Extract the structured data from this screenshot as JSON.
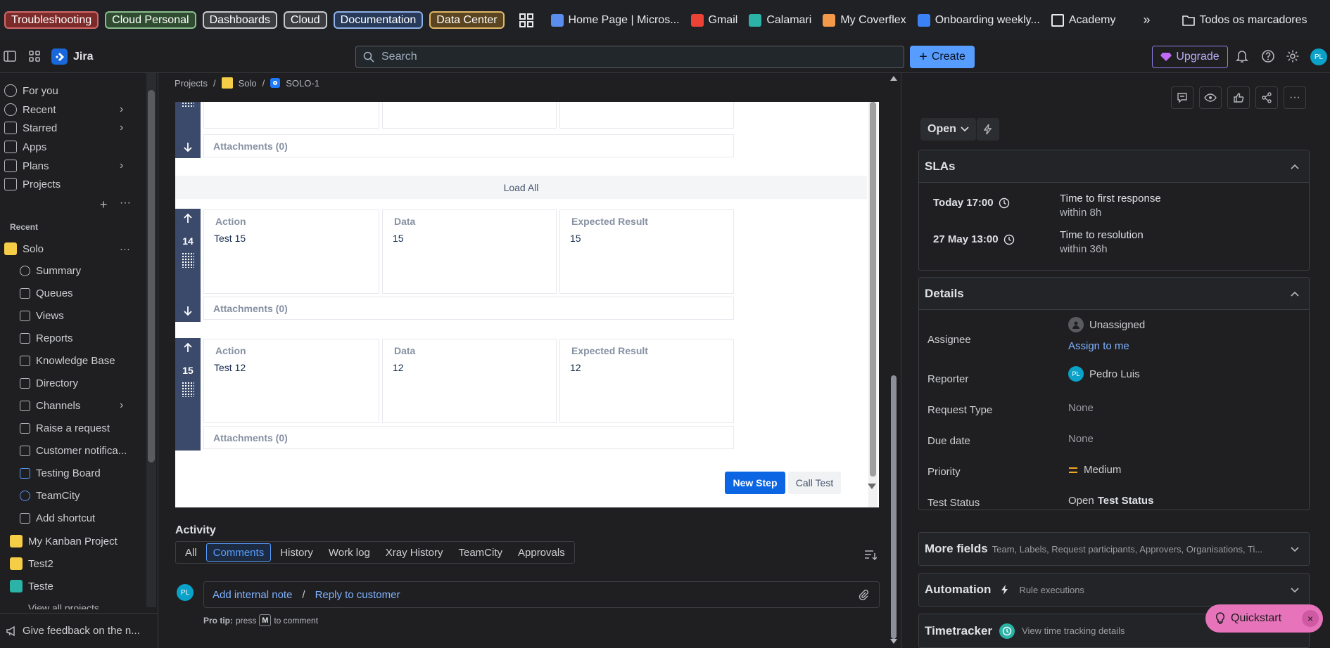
{
  "bookmarks": {
    "folders": [
      {
        "label": "Troubleshooting",
        "bg": "#7d2a2a",
        "border": "#d0686a"
      },
      {
        "label": "Cloud Personal",
        "bg": "#2f4c30",
        "border": "#8bbd8e"
      },
      {
        "label": "Dashboards",
        "bg": "#3b3d40",
        "border": "#c8c9cc"
      },
      {
        "label": "Cloud",
        "bg": "#3b3d40",
        "border": "#c8c9cc"
      },
      {
        "label": "Documentation",
        "bg": "#283a5a",
        "border": "#8fb0e8"
      },
      {
        "label": "Data Center",
        "bg": "#5a4520",
        "border": "#e0b768"
      }
    ],
    "links": [
      {
        "label": "Home Page | Micros...",
        "icon": "microsoft-icon",
        "color": "#5b8def"
      },
      {
        "label": "Gmail",
        "icon": "gmail-icon",
        "color": "#ea4335"
      },
      {
        "label": "Calamari",
        "icon": "calamari-icon",
        "color": "#2ab3a6"
      },
      {
        "label": "My Coverflex",
        "icon": "coverflex-icon",
        "color": "#f2994a"
      },
      {
        "label": "Onboarding weekly...",
        "icon": "onboarding-icon",
        "color": "#3b82f6"
      },
      {
        "label": "Academy",
        "icon": "folder-icon",
        "color": "#e8eaed"
      }
    ],
    "other_folder": "Todos os marcadores"
  },
  "topnav": {
    "app_name": "Jira",
    "search_placeholder": "Search",
    "create_label": "Create",
    "upgrade_label": "Upgrade",
    "avatar_initials": "PL"
  },
  "sidebar": {
    "items": [
      {
        "label": "For you",
        "icon": "user-circle-icon"
      },
      {
        "label": "Recent",
        "icon": "clock-icon"
      },
      {
        "label": "Starred",
        "icon": "star-icon"
      },
      {
        "label": "Apps",
        "icon": "apps-icon"
      },
      {
        "label": "Plans",
        "icon": "plans-icon"
      },
      {
        "label": "Projects",
        "icon": "projects-icon"
      }
    ],
    "recent_label": "Recent",
    "project": "Solo",
    "sub_items": [
      {
        "label": "Summary",
        "icon": "globe-icon"
      },
      {
        "label": "Queues",
        "icon": "queues-icon"
      },
      {
        "label": "Views",
        "icon": "views-icon"
      },
      {
        "label": "Reports",
        "icon": "reports-icon"
      },
      {
        "label": "Knowledge Base",
        "icon": "book-icon"
      },
      {
        "label": "Directory",
        "icon": "directory-icon"
      },
      {
        "label": "Channels",
        "icon": "channels-icon"
      },
      {
        "label": "Raise a request",
        "icon": "plus-square-icon"
      },
      {
        "label": "Customer notifica...",
        "icon": "mail-icon"
      },
      {
        "label": "Testing Board",
        "icon": "lightning-icon"
      },
      {
        "label": "TeamCity",
        "icon": "teamcity-icon"
      },
      {
        "label": "Add shortcut",
        "icon": "add-shortcut-icon"
      }
    ],
    "other_projects": [
      "My Kanban Project",
      "Test2",
      "Teste"
    ],
    "view_all": "View all projects",
    "feedback": "Give feedback on the n..."
  },
  "breadcrumb": [
    "Projects",
    "Solo",
    "SOLO-1"
  ],
  "steps": {
    "top_attachments": "Attachments (0)",
    "load_all": "Load All",
    "rows": [
      {
        "number": "14",
        "action": "Test 15",
        "data": "15",
        "expected": "15"
      },
      {
        "number": "15",
        "action": "Test 12",
        "data": "12",
        "expected": "12"
      }
    ],
    "col_action": "Action",
    "col_data": "Data",
    "col_expected": "Expected Result",
    "attachments": "Attachments (0)",
    "new_step": "New Step",
    "call_test": "Call Test"
  },
  "activity": {
    "title": "Activity",
    "tabs": [
      "All",
      "Comments",
      "History",
      "Work log",
      "Xray History",
      "TeamCity",
      "Approvals"
    ],
    "active_tab": "Comments",
    "add_note": "Add internal note",
    "separator": "/",
    "reply": "Reply to customer",
    "protip_prefix": "Pro tip:",
    "protip_press": "press",
    "protip_key": "M",
    "protip_suffix": "to comment"
  },
  "right": {
    "status": "Open",
    "slas_title": "SLAs",
    "slas": [
      {
        "time": "Today 17:00",
        "title": "Time to first response",
        "sub": "within 8h"
      },
      {
        "time": "27 May 13:00",
        "title": "Time to resolution",
        "sub": "within 36h"
      }
    ],
    "details_title": "Details",
    "assignee_label": "Assignee",
    "assignee_value": "Unassigned",
    "assign_me": "Assign to me",
    "reporter_label": "Reporter",
    "reporter_value": "Pedro Luis",
    "reporter_initials": "PL",
    "request_type_label": "Request Type",
    "request_type_value": "None",
    "due_date_label": "Due date",
    "due_date_value": "None",
    "priority_label": "Priority",
    "priority_value": "Medium",
    "test_status_label": "Test Status",
    "test_status_value": "Open",
    "test_status_bold": "Test Status",
    "more_fields_title": "More fields",
    "more_fields_sub": "Team, Labels, Request participants, Approvers, Organisations, Ti...",
    "automation_title": "Automation",
    "automation_sub": "Rule executions",
    "timetracker_title": "Timetracker",
    "timetracker_sub": "View time tracking details"
  },
  "quickstart": {
    "label": "Quickstart",
    "close": "×"
  }
}
